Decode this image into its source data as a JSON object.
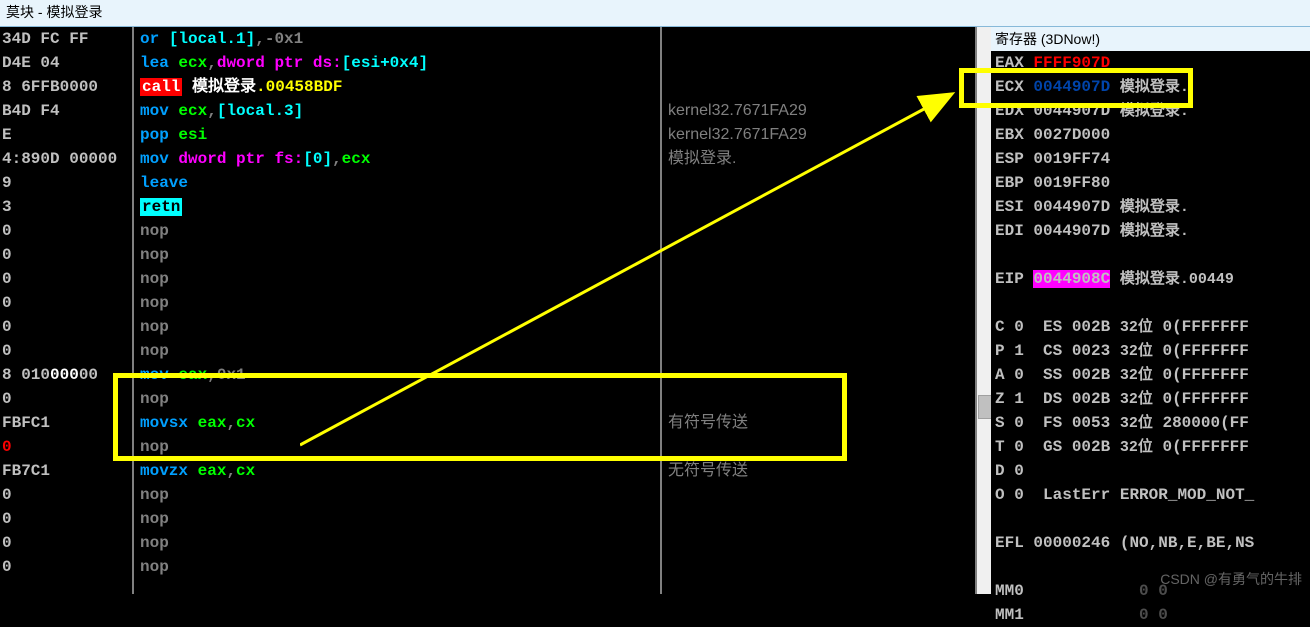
{
  "title": "莫块 - 模拟登录",
  "reg_title": "寄存器 (3DNow!)",
  "diss": [
    {
      "b": "34D FC FF",
      "m": "or",
      "arg": "[local.1]",
      "comma": ",",
      "arg2": "-0x1",
      "t": "or_mem_imm"
    },
    {
      "b": "D4E 04",
      "m": "lea",
      "arg": "ecx",
      "comma": ",",
      "rest": "dword ptr ds:[esi+0x4]",
      "t": "lea"
    },
    {
      "b": "8 6FFB0000",
      "m": "call",
      "arg": " 模拟登录.00458BDF",
      "t": "call"
    },
    {
      "b": "B4D F4",
      "m": "mov",
      "arg": "ecx",
      "comma": ",",
      "arg2": "[local.3]",
      "t": "mov_reg_mem",
      "cmt": "kernel32.7671FA29"
    },
    {
      "b": "E",
      "m": "pop",
      "arg": "esi",
      "t": "pop",
      "cmt": "kernel32.7671FA29"
    },
    {
      "b": "4:890D 00000",
      "m": "mov",
      "rest": "dword ptr fs:[0]",
      "comma": ",",
      "arg2": "ecx",
      "t": "mov_mem_reg",
      "cmt": "模拟登录.<ModuleEntryPo"
    },
    {
      "b": "9",
      "m": "leave",
      "t": "leave"
    },
    {
      "b": "3",
      "m": "retn",
      "t": "retn"
    },
    {
      "b": "0",
      "m": "nop",
      "t": "nop"
    },
    {
      "b": "0",
      "m": "nop",
      "t": "nop"
    },
    {
      "b": "0",
      "m": "nop",
      "t": "nop"
    },
    {
      "b": "0",
      "m": "nop",
      "t": "nop"
    },
    {
      "b": "0",
      "m": "nop",
      "t": "nop"
    },
    {
      "b": "0",
      "m": "nop",
      "t": "nop"
    },
    {
      "b": "8 01000000",
      "m": "mov",
      "arg": "eax",
      "comma": ",",
      "arg2": "0x1",
      "t": "mov_reg_imm"
    },
    {
      "b": "0",
      "m": "nop",
      "t": "nop"
    },
    {
      "b": "FBFC1",
      "m": "movsx",
      "arg": "eax",
      "comma": ",",
      "arg2": "cx",
      "t": "movsx",
      "cmt": "有符号传送"
    },
    {
      "b": "0",
      "m": "nop",
      "t": "nop",
      "sel": true,
      "byte_red": true
    },
    {
      "b": "FB7C1",
      "m": "movzx",
      "arg": "eax",
      "comma": ",",
      "arg2": "cx",
      "t": "movzx",
      "cmt": "无符号传送"
    },
    {
      "b": "0",
      "m": "nop",
      "t": "nop"
    },
    {
      "b": "0",
      "m": "nop",
      "t": "nop"
    },
    {
      "b": "0",
      "m": "nop",
      "t": "nop"
    },
    {
      "b": "0",
      "m": "nop",
      "t": "nop"
    }
  ],
  "regs": [
    {
      "n": "EAX",
      "v": "FFFF907D",
      "chg": true
    },
    {
      "n": "ECX",
      "v": "0044907D",
      "c": "模拟登录.<Modu",
      "vhid": true
    },
    {
      "n": "EDX",
      "v": "0044907D",
      "c": "模拟登录.<Modu"
    },
    {
      "n": "EBX",
      "v": "0027D000"
    },
    {
      "n": "ESP",
      "v": "0019FF74"
    },
    {
      "n": "EBP",
      "v": "0019FF80"
    },
    {
      "n": "ESI",
      "v": "0044907D",
      "c": "模拟登录.<Modu"
    },
    {
      "n": "EDI",
      "v": "0044907D",
      "c": "模拟登录.<Modu"
    }
  ],
  "eip": {
    "n": "EIP",
    "v": "0044908C",
    "c": "模拟登录.00449"
  },
  "flags": [
    {
      "f": "C",
      "v": "0",
      "s": "ES",
      "sv": "002B",
      "bits": "32位",
      "extra": "0(FFFFFFF"
    },
    {
      "f": "P",
      "v": "1",
      "s": "CS",
      "sv": "0023",
      "bits": "32位",
      "extra": "0(FFFFFFF"
    },
    {
      "f": "A",
      "v": "0",
      "s": "SS",
      "sv": "002B",
      "bits": "32位",
      "extra": "0(FFFFFFF"
    },
    {
      "f": "Z",
      "v": "1",
      "s": "DS",
      "sv": "002B",
      "bits": "32位",
      "extra": "0(FFFFFFF"
    },
    {
      "f": "S",
      "v": "0",
      "s": "FS",
      "sv": "0053",
      "bits": "32位",
      "extra": "280000(FF"
    },
    {
      "f": "T",
      "v": "0",
      "s": "GS",
      "sv": "002B",
      "bits": "32位",
      "extra": "0(FFFFFFF"
    },
    {
      "f": "D",
      "v": "0"
    },
    {
      "f": "O",
      "v": "0",
      "s": "LastErr",
      "extra": "ERROR_MOD_NOT_"
    }
  ],
  "efl": {
    "n": "EFL",
    "v": "00000246",
    "c": "(NO,NB,E,BE,NS"
  },
  "mm": [
    {
      "n": "MM0",
      "v": "0 0"
    },
    {
      "n": "MM1",
      "v": "0 0"
    }
  ],
  "watermark": "CSDN @有勇气的牛排"
}
